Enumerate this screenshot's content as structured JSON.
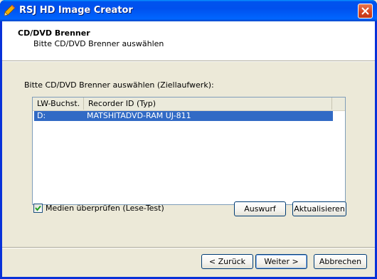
{
  "window": {
    "title": "RSJ HD Image Creator"
  },
  "header": {
    "title": "CD/DVD Brenner",
    "subtitle": "Bitte CD/DVD Brenner auswählen"
  },
  "main": {
    "prompt": "Bitte CD/DVD Brenner auswählen (Ziellaufwerk):",
    "list": {
      "columns": [
        "LW-Buchst.",
        "Recorder ID (Typ)"
      ],
      "rows": [
        {
          "drive": "D:",
          "recorder": "MATSHITADVD-RAM UJ-811",
          "selected": true
        }
      ]
    },
    "verify_checkbox": {
      "label": "Medien überprüfen (Lese-Test)",
      "checked": true
    },
    "buttons": {
      "eject": "Auswurf",
      "refresh": "Aktualisieren"
    }
  },
  "footer": {
    "back": "< Zurück",
    "next": "Weiter >",
    "cancel": "Abbrechen"
  },
  "colors": {
    "title_bar": "#0053ee",
    "selection": "#316ac5",
    "face": "#ece9d8"
  },
  "icons": {
    "app": "pencil-icon",
    "close": "close-icon",
    "check": "checkmark-icon"
  }
}
